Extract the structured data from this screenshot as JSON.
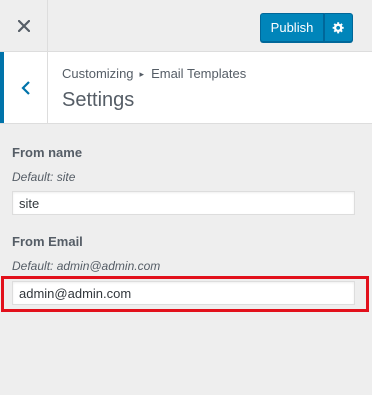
{
  "header": {
    "close_icon": "close-icon",
    "publish_label": "Publish",
    "settings_icon": "gear-icon",
    "accent_color": "#0085ba"
  },
  "section": {
    "back_icon": "chevron-left-icon",
    "breadcrumb_root": "Customizing",
    "breadcrumb_separator": "▸",
    "breadcrumb_current": "Email Templates",
    "title": "Settings"
  },
  "fields": {
    "from_name": {
      "label": "From name",
      "description": "Default: site",
      "value": "site"
    },
    "from_email": {
      "label": "From Email",
      "description": "Default: admin@admin.com",
      "value": "admin@admin.com"
    }
  },
  "highlight_color": "#e2101b"
}
